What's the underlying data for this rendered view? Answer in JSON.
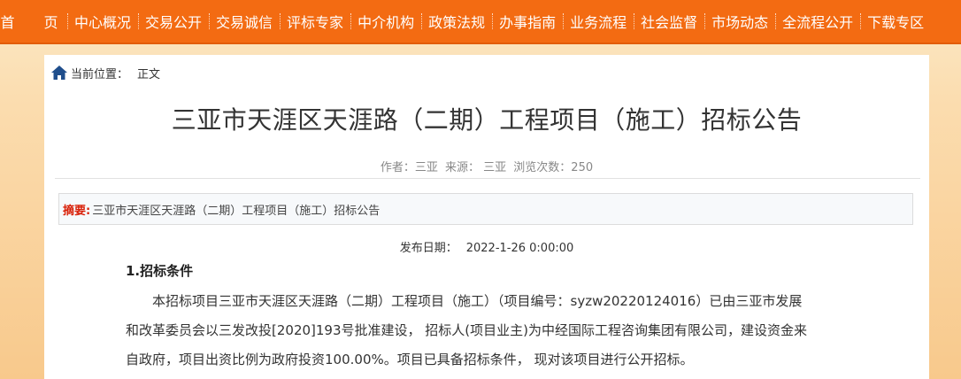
{
  "nav": {
    "items": [
      "首 页",
      "中心概况",
      "交易公开",
      "交易诚信",
      "评标专家",
      "中介机构",
      "政策法规",
      "办事指南",
      "业务流程",
      "社会监督",
      "市场动态",
      "全流程公开",
      "下载专区"
    ]
  },
  "breadcrumb": {
    "icon": "home-icon",
    "label": "当前位置：",
    "current": "正文"
  },
  "article": {
    "title": "三亚市天涯区天涯路（二期）工程项目（施工）招标公告",
    "author": "作者：三亚",
    "source": "来源：  三亚",
    "views": "浏览次数：250",
    "summary_label": "摘要:",
    "summary_text": "三亚市天涯区天涯路（二期）工程项目（施工）招标公告",
    "pubdate_label": "发布日期：",
    "pubdate_value": "2022-1-26 0:00:00",
    "section1_heading": "1.招标条件",
    "paragraph_lines": [
      "本招标项目三亚市天涯区天涯路（二期）工程项目（施工）（项目编号：syzw20220124016）已由三亚市发展",
      "和改革委员会以三发改投[2020]193号批准建设， 招标人(项目业主)为中经国际工程咨询集团有限公司，建设资金来",
      "自政府，项目出资比例为政府投资100.00%。项目已具备招标条件， 现对该项目进行公开招标。"
    ]
  },
  "colors": {
    "nav_bg": "#f36b12",
    "summary_label": "#d81e06",
    "home_icon": "#1f4e8c"
  }
}
